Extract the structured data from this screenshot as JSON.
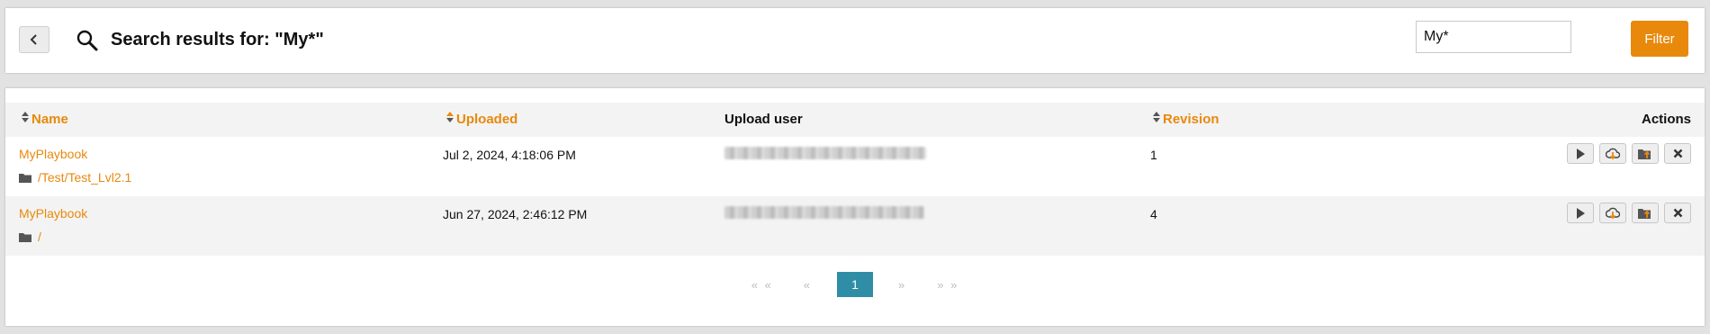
{
  "header": {
    "back_button_label": "",
    "title": "Search results for: \"My*\"",
    "search_value": "My*",
    "search_placeholder": "",
    "filter_label": "Filter"
  },
  "table": {
    "columns": {
      "name": "Name",
      "uploaded": "Uploaded",
      "upload_user": "Upload user",
      "revision": "Revision",
      "actions": "Actions"
    },
    "rows": [
      {
        "name": "MyPlaybook",
        "path": "/Test/Test_Lvl2.1",
        "uploaded": "Jul 2, 2024, 4:18:06 PM",
        "revision": "1"
      },
      {
        "name": "MyPlaybook",
        "path": "/",
        "uploaded": "Jun 27, 2024, 2:46:12 PM",
        "revision": "4"
      }
    ]
  },
  "pagination": {
    "first": "« «",
    "prev": "«",
    "current": "1",
    "next": "»",
    "last": "» »"
  },
  "colors": {
    "accent": "#e8890c",
    "page_active": "#2f8ea6",
    "row_alt": "#f3f3f3"
  },
  "icons": [
    "chevron-left-icon",
    "search-icon",
    "sort-icon",
    "folder-icon",
    "play-icon",
    "cloud-download-icon",
    "folder-upload-icon",
    "close-icon"
  ]
}
